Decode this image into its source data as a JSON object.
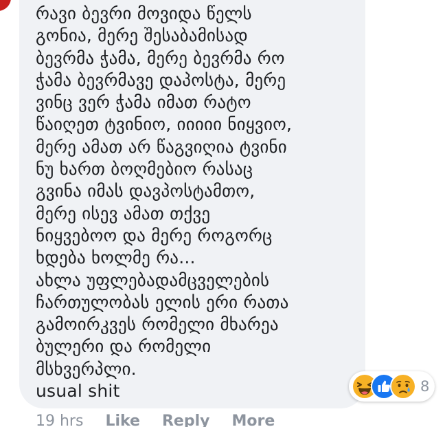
{
  "comment": {
    "text": "რავი ბევრი მოვიდა წელს\nგონია, მერე შესაბამისად\nბევრმა ჭამა, მერე ბევრმა რო\nჭამა ბევრმავე დაპოსტა, მერე\nვინც ვერ ჭამა იმათ რატო\nწაიღეთ ტვინიო, იიიიი ნიყვიო,\nმერე ამათ არ წაგვიღია ტვინი\nნუ ხართ ბოღმებიო რასაც\nგვინა იმას დავპოსტამთო,\nმერე ისევ ამათ თქვე\nნიყვებოო და მერე როგორც\nხდება ხოლმე რა...\nახლა უფლებადამცველების\nჩართულობას ელის ერი რათა\nგამოირკვეს რომელი მხარეა\nბულერი და რომელი\nმსხვერპლი.\nusual shit"
  },
  "reactions": {
    "icons": [
      "haha-icon",
      "like-icon",
      "sad-icon"
    ],
    "count": "8"
  },
  "actions": {
    "time": "19 hrs",
    "like": "Like",
    "reply": "Reply",
    "more": "More"
  },
  "colors": {
    "bubble": "#f0f2f5",
    "like_blue": "#1877f2",
    "emoji_yellow": "#f7b125",
    "meta_gray": "#8d949e",
    "avatar_red": "#c8201e"
  }
}
